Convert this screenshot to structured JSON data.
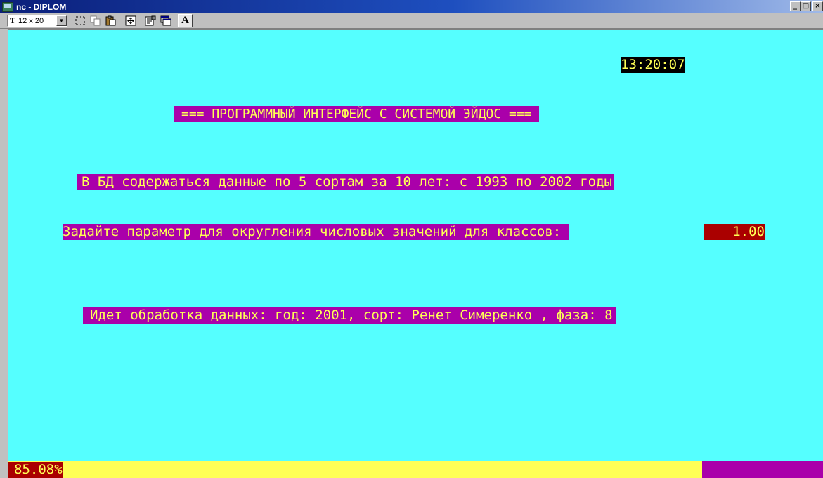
{
  "window": {
    "title": "nc - DIPLOM",
    "buttons": {
      "minimize": "_",
      "maximize": "□",
      "close": "×"
    }
  },
  "toolbar": {
    "font_size": "12 x 20",
    "font_icon": "T",
    "font_button": "A",
    "icons": [
      "mark-icon",
      "copy-icon",
      "paste-icon",
      "fullscreen-icon",
      "properties-icon",
      "background-icon",
      "font-icon"
    ]
  },
  "console": {
    "clock": "13:20:07",
    "banner": "=== ПРОГРАММНЫЙ ИНТЕРФЕЙС С СИСТЕМОЙ ЭЙДОС ===",
    "info": "В БД содержаться данные по 5 сортам за 10 лет: с 1993 по 2002 годы",
    "prompt": "Задайте параметр для округления числовых значений для классов: ",
    "param_value": "1.00",
    "status": "Идет обработка данных: год: 2001, сорт: Ренет Симеренко , фаза: 8",
    "progress_label": "85.08%",
    "progress_fraction": 0.8508
  },
  "colors": {
    "background": "#55ffff",
    "highlight": "#aa00aa",
    "text": "#ffff55",
    "input_bg": "#aa0000",
    "progress_fill": "#ffff55"
  }
}
